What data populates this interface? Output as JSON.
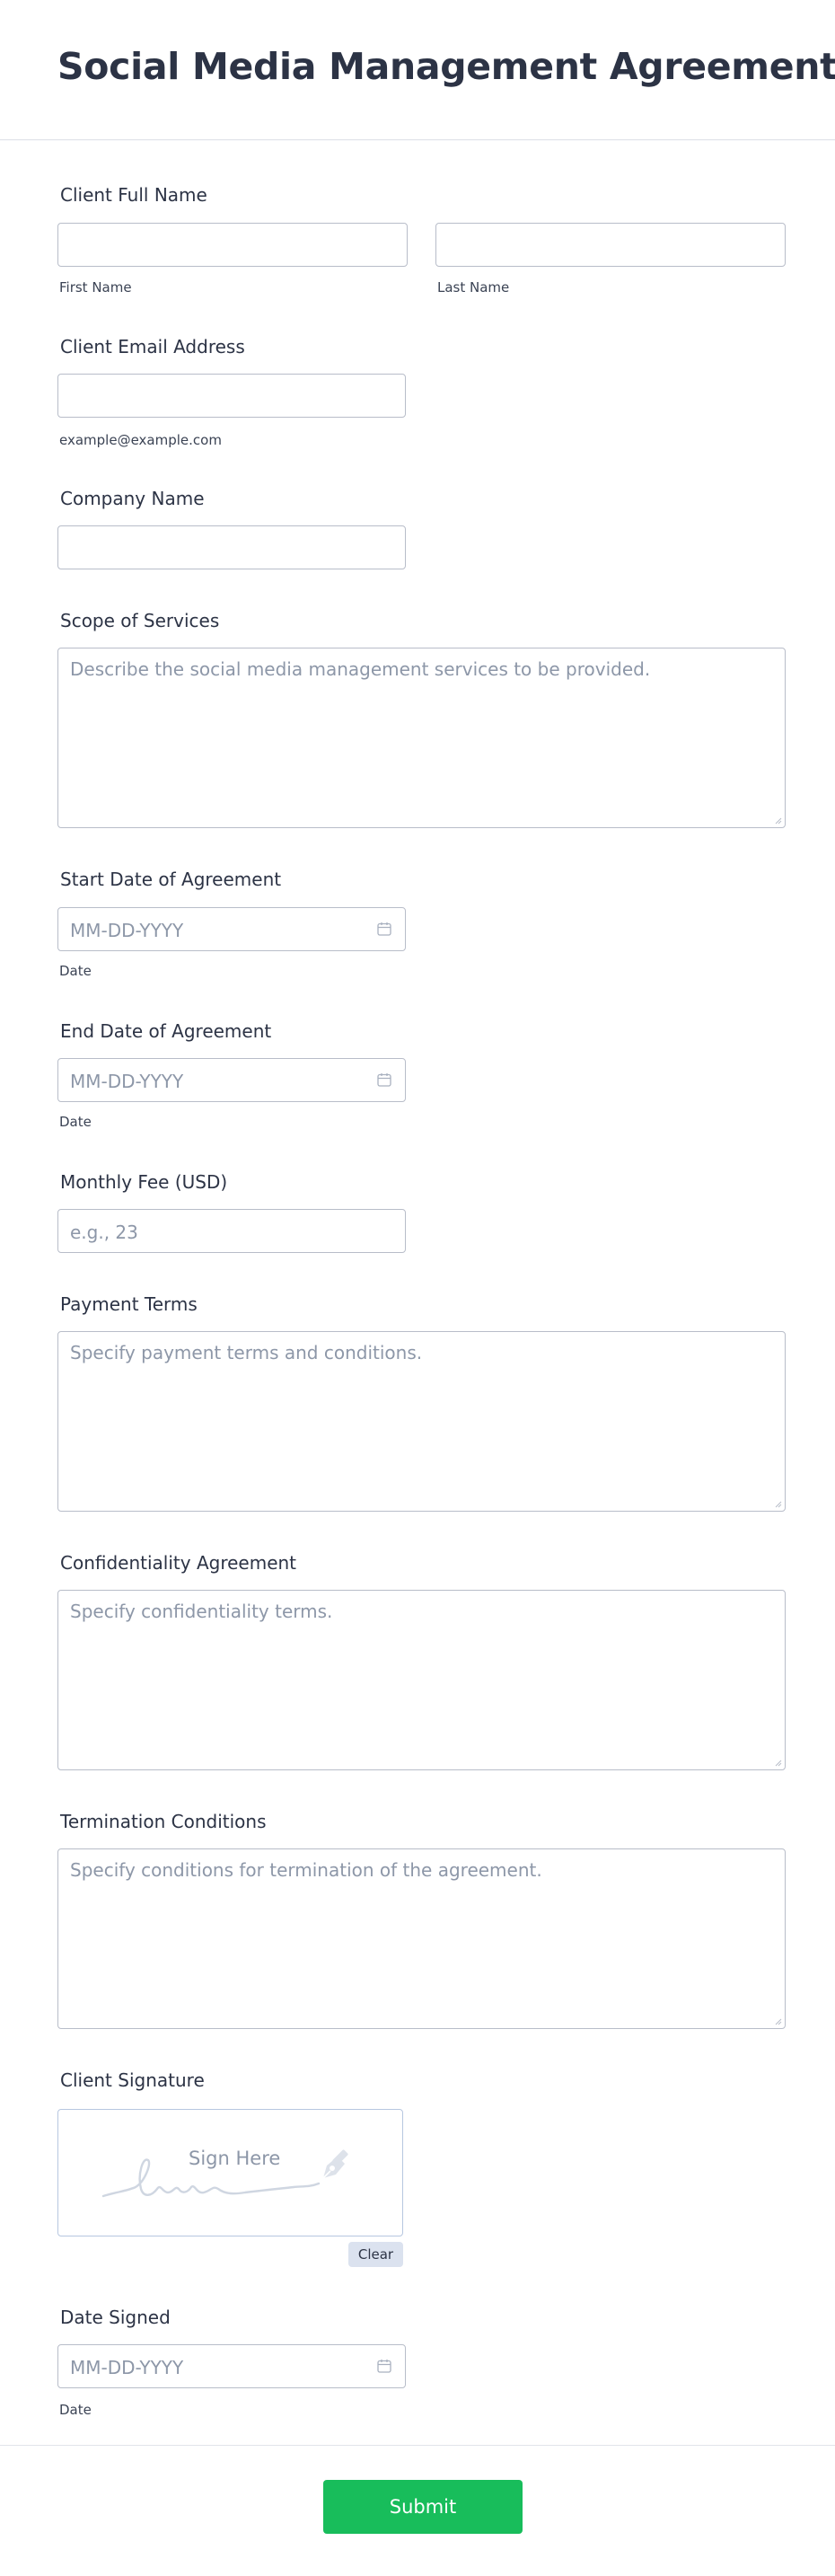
{
  "form": {
    "title": "Social Media Management Agreement",
    "client_full_name": {
      "label": "Client Full Name",
      "first_sublabel": "First Name",
      "last_sublabel": "Last Name",
      "first_value": "",
      "last_value": ""
    },
    "client_email": {
      "label": "Client Email Address",
      "sublabel": "example@example.com",
      "value": ""
    },
    "company_name": {
      "label": "Company Name",
      "value": ""
    },
    "scope_of_services": {
      "label": "Scope of Services",
      "placeholder": "Describe the social media management services to be provided."
    },
    "start_date": {
      "label": "Start Date of Agreement",
      "placeholder": "MM-DD-YYYY",
      "sublabel": "Date",
      "icon": "calendar-icon"
    },
    "end_date": {
      "label": "End Date of Agreement",
      "placeholder": "MM-DD-YYYY",
      "sublabel": "Date",
      "icon": "calendar-icon"
    },
    "monthly_fee": {
      "label": "Monthly Fee (USD)",
      "placeholder": "e.g., 23"
    },
    "payment_terms": {
      "label": "Payment Terms",
      "placeholder": "Specify payment terms and conditions."
    },
    "confidentiality": {
      "label": "Confidentiality Agreement",
      "placeholder": "Specify confidentiality terms."
    },
    "termination": {
      "label": "Termination Conditions",
      "placeholder": "Specify conditions for termination of the agreement."
    },
    "signature": {
      "label": "Client Signature",
      "prompt": "Sign Here",
      "clear_label": "Clear",
      "icon": "pen-nib-icon"
    },
    "date_signed": {
      "label": "Date Signed",
      "placeholder": "MM-DD-YYYY",
      "sublabel": "Date",
      "icon": "calendar-icon"
    },
    "submit_label": "Submit"
  },
  "colors": {
    "title": "#2c3345",
    "input_border": "#b8bdc9",
    "placeholder": "#8d97a8",
    "submit_bg": "#18bd5b",
    "clear_bg": "#dbe2ef"
  }
}
